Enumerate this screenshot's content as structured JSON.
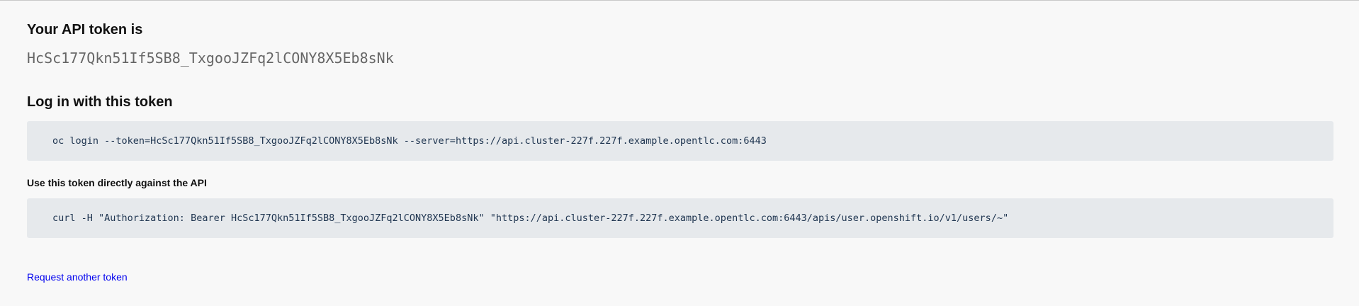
{
  "token_section": {
    "heading": "Your API token is",
    "token": "HcSc177Qkn51If5SB8_TxgooJZFq2lCONY8X5Eb8sNk"
  },
  "login_section": {
    "heading": "Log in with this token",
    "command": "oc login --token=HcSc177Qkn51If5SB8_TxgooJZFq2lCONY8X5Eb8sNk --server=https://api.cluster-227f.227f.example.opentlc.com:6443"
  },
  "api_section": {
    "heading": "Use this token directly against the API",
    "command": "curl -H \"Authorization: Bearer HcSc177Qkn51If5SB8_TxgooJZFq2lCONY8X5Eb8sNk\" \"https://api.cluster-227f.227f.example.opentlc.com:6443/apis/user.openshift.io/v1/users/~\""
  },
  "actions": {
    "request_another_label": "Request another token"
  },
  "colors": {
    "page_background": "#f8f8f8",
    "code_background": "#e6e9ec",
    "code_text": "#1f3550",
    "link": "#0000ee",
    "token_text": "#666666"
  }
}
